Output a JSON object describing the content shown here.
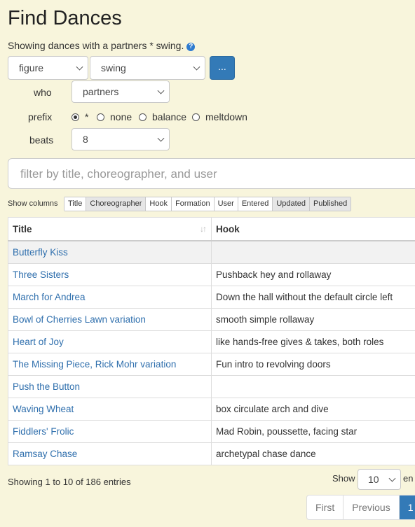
{
  "page": {
    "title": "Find Dances",
    "summary": "Showing dances with a partners * swing.",
    "help_icon": "?"
  },
  "query": {
    "figure_select": "figure",
    "move_select": "swing",
    "more_button": "...",
    "who_label": "who",
    "who_select": "partners",
    "prefix_label": "prefix",
    "prefix_options": [
      "*",
      "none",
      "balance",
      "meltdown"
    ],
    "prefix_selected": "*",
    "beats_label": "beats",
    "beats_select": "8"
  },
  "filter": {
    "placeholder": "filter by title, choreographer, and user"
  },
  "columns": {
    "label": "Show columns",
    "toggles": [
      {
        "label": "Title",
        "on": false
      },
      {
        "label": "Choreographer",
        "on": true
      },
      {
        "label": "Hook",
        "on": false
      },
      {
        "label": "Formation",
        "on": false
      },
      {
        "label": "User",
        "on": false
      },
      {
        "label": "Entered",
        "on": false
      },
      {
        "label": "Updated",
        "on": true
      },
      {
        "label": "Published",
        "on": true
      }
    ]
  },
  "table": {
    "headers": [
      "Title",
      "Hook"
    ],
    "rows": [
      {
        "title": "Butterfly Kiss",
        "hook": ""
      },
      {
        "title": "Three Sisters",
        "hook": "Pushback hey and rollaway"
      },
      {
        "title": "March for Andrea",
        "hook": "Down the hall without the default circle left"
      },
      {
        "title": "Bowl of Cherries Lawn variation",
        "hook": "smooth simple rollaway"
      },
      {
        "title": "Heart of Joy",
        "hook": "like hands-free gives & takes, both roles"
      },
      {
        "title": "The Missing Piece, Rick Mohr variation",
        "hook": "Fun intro to revolving doors"
      },
      {
        "title": "Push the Button",
        "hook": ""
      },
      {
        "title": "Waving Wheat",
        "hook": "box circulate arch and dive"
      },
      {
        "title": "Fiddlers' Frolic",
        "hook": "Mad Robin, poussette, facing star"
      },
      {
        "title": "Ramsay Chase",
        "hook": "archetypal chase dance"
      }
    ]
  },
  "footer": {
    "info": "Showing 1 to 10 of 186 entries",
    "show_label": "Show",
    "page_length": "10",
    "entries_label_cut": "en",
    "pagination": [
      "First",
      "Previous",
      "1"
    ]
  },
  "colors": {
    "accent": "#337ab7",
    "link": "#2f6fad",
    "background": "#f8f5dc"
  }
}
